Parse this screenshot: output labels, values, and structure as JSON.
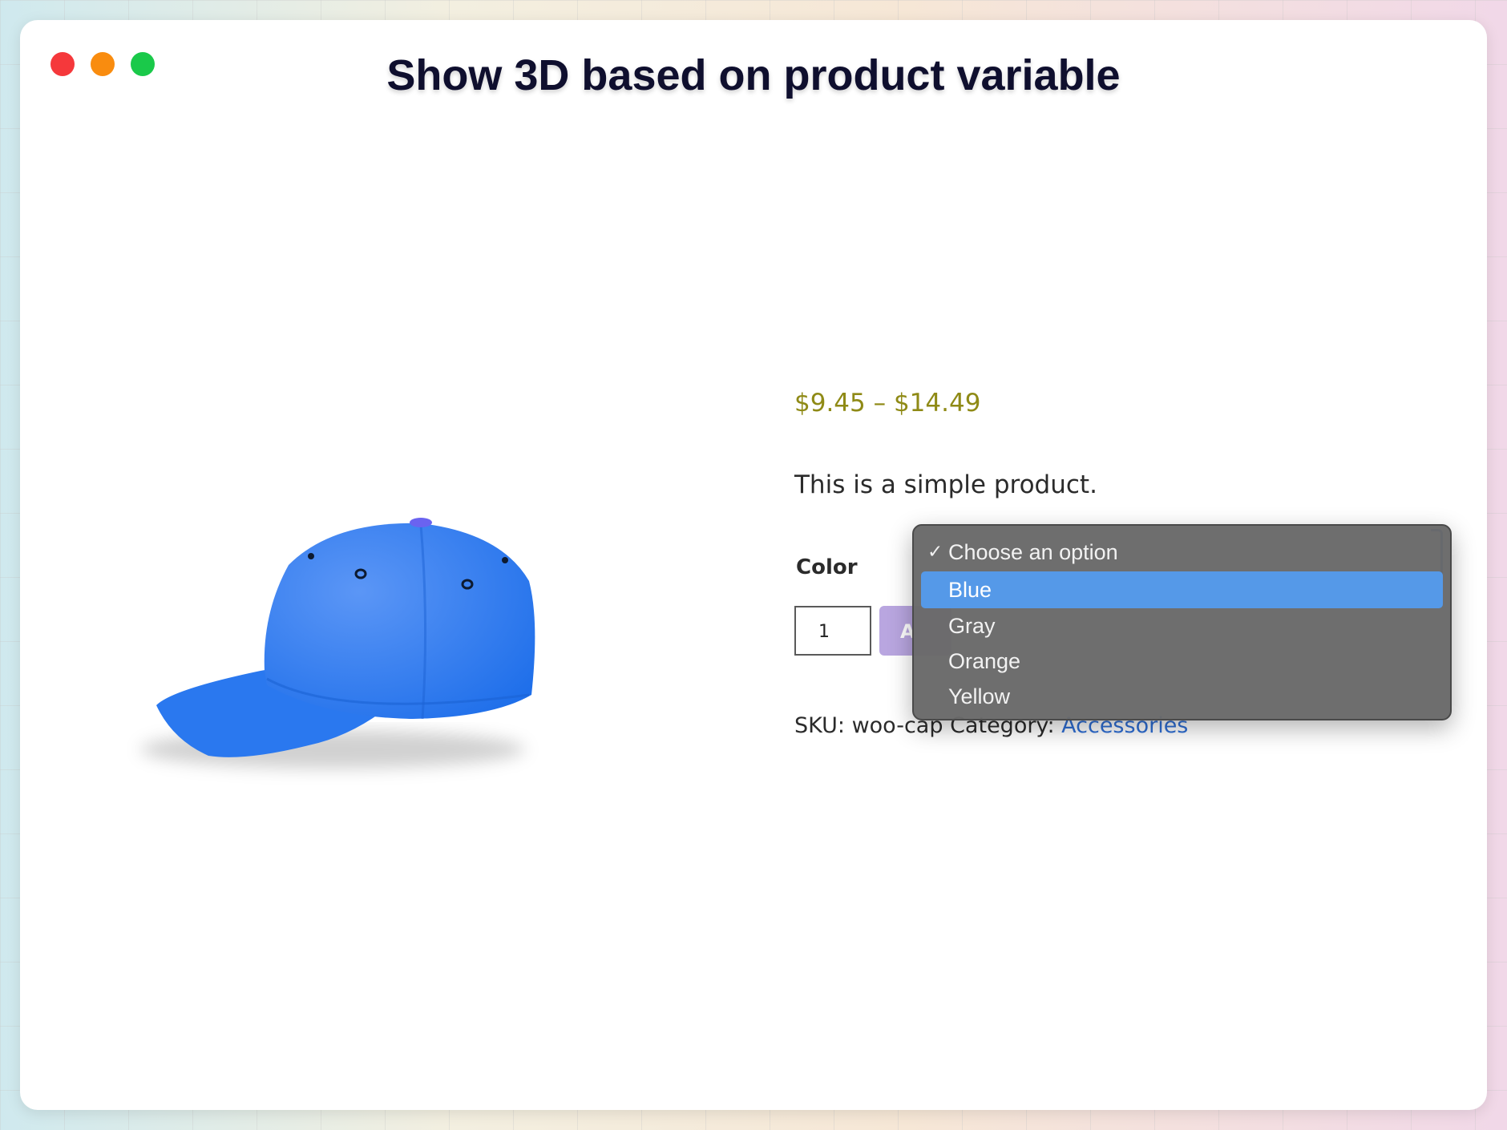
{
  "window": {
    "title": "Show 3D based on product variable",
    "controls": [
      "close",
      "minimize",
      "maximize"
    ]
  },
  "product": {
    "price": "$9.45 – $14.49",
    "description": "This is a simple product.",
    "image_icon": "cap-3d-model",
    "image_color": "#2f7df0",
    "variation": {
      "label": "Color",
      "selected": "Choose an option",
      "options": [
        "Choose an option",
        "Blue",
        "Gray",
        "Orange",
        "Yellow"
      ],
      "highlighted": "Blue"
    },
    "quantity": "1",
    "add_to_cart_label": "A",
    "sku_label": "SKU:",
    "sku_value": "woo-cap",
    "category_label": "Category:",
    "category_value": "Accessories"
  },
  "dropdown": {
    "check_glyph": "✓",
    "items": [
      {
        "label": "Choose an option",
        "checked": true
      },
      {
        "label": "Blue",
        "highlighted": true
      },
      {
        "label": "Gray"
      },
      {
        "label": "Orange"
      },
      {
        "label": "Yellow"
      }
    ]
  },
  "colors": {
    "price": "#8f8a16",
    "link": "#2f6fd6",
    "highlight": "#5599e8",
    "button": "#b9a6e0"
  }
}
